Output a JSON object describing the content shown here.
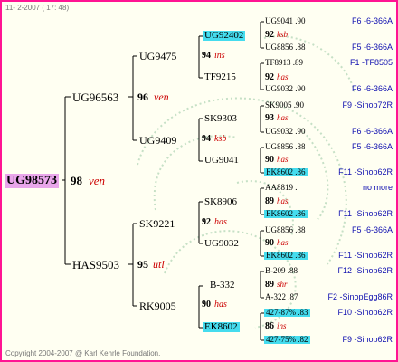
{
  "header": {
    "date_text": "11- 2-2007 ( 17: 48)"
  },
  "footer": {
    "copyright": "Copyright 2004-2007 @ Karl Kehrle Foundation."
  },
  "root": {
    "id": "UG98573",
    "value": "98",
    "code": "ven"
  },
  "gen1": [
    {
      "id": "UG96563",
      "value": "96",
      "code": "ven"
    },
    {
      "id": "HAS9503",
      "value": "95",
      "code": "utl"
    }
  ],
  "gen2": [
    {
      "id": "UG9475",
      "value": "94",
      "code": "ins"
    },
    {
      "id": "UG9409",
      "value": "94",
      "code": "ksb"
    },
    {
      "id": "SK9221",
      "value": "92",
      "code": "has"
    },
    {
      "id": "RK9005",
      "value": "90",
      "code": "has"
    }
  ],
  "gen3": [
    {
      "id": "UG92402",
      "value": "92",
      "code": "ksb"
    },
    {
      "id": "TF9215",
      "value": "92",
      "code": "has"
    },
    {
      "id": "SK9303",
      "value": "93",
      "code": "has"
    },
    {
      "id": "UG9041",
      "value": "90",
      "code": "has"
    },
    {
      "id": "SK8906",
      "value": "89",
      "code": "has"
    },
    {
      "id": "UG9032",
      "value": "90",
      "code": "has"
    },
    {
      "id": "B-332",
      "value": "89",
      "code": "shr"
    },
    {
      "id": "EK8602",
      "value": "86",
      "code": "ins"
    }
  ],
  "gen4": [
    {
      "text": "UG9041 .90",
      "name": "F6 -6-366A"
    },
    {
      "text": "UG8856 .88",
      "name": "F5 -6-366A"
    },
    {
      "text": "TF8913 .89",
      "name": "F1 -TF8505"
    },
    {
      "text": "UG9032 .90",
      "name": "F6 -6-366A"
    },
    {
      "text": "SK9005 .90",
      "name": "F9 -Sinop72R"
    },
    {
      "text": "UG9032 .90",
      "name": "F6 -6-366A"
    },
    {
      "text": "UG8856 .88",
      "name": "F5 -6-366A"
    },
    {
      "text": "EK8602 .86",
      "name": "F11 -Sinop62R"
    },
    {
      "text": "AA8819 .",
      "name": "no more"
    },
    {
      "text": "EK8602 .86",
      "name": "F11 -Sinop62R"
    },
    {
      "text": "UG8856 .88",
      "name": "F5 -6-366A"
    },
    {
      "text": "EK8602 .86",
      "name": "F11 -Sinop62R"
    },
    {
      "text": "B-209 .88",
      "name": "F12 -Sinop62R"
    },
    {
      "text": "A-322 .87",
      "name": "F2 -SinopEgg86R"
    },
    {
      "text": "427-87% .83",
      "name": "F10 -Sinop62R"
    },
    {
      "text": "427-75% .82",
      "name": "F9 -Sinop62R"
    }
  ],
  "colors": {
    "border": "#ff1493",
    "highlight": "#45dcee",
    "root_highlight": "#e9a6ea",
    "code": "#cc0000",
    "name": "#1010b0"
  }
}
